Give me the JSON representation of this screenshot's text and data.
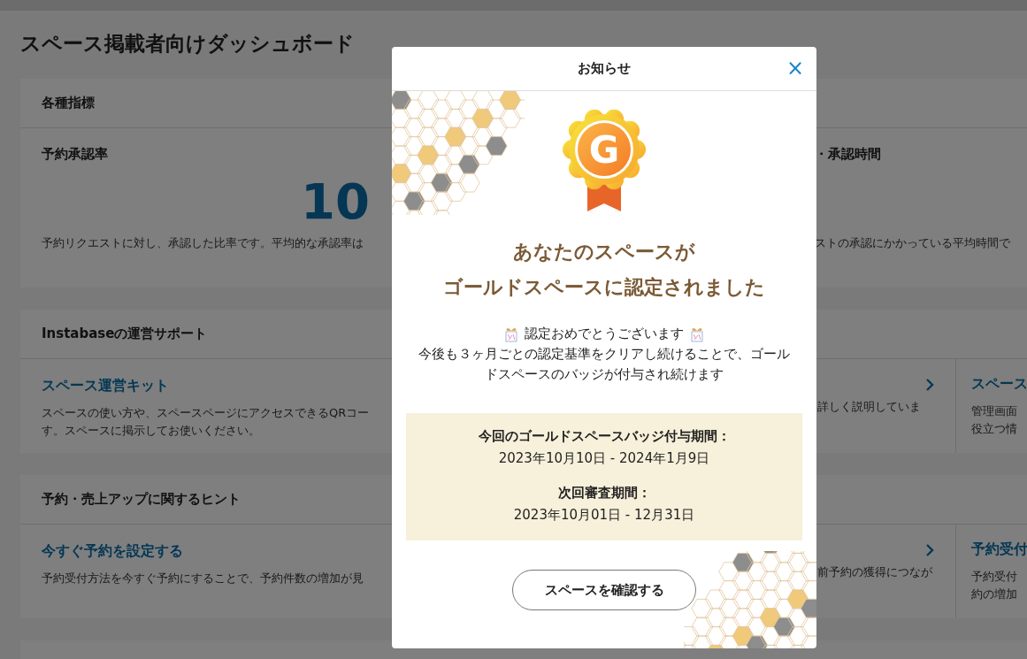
{
  "page": {
    "title": "スペース掲載者向けダッシュボード"
  },
  "sections": [
    {
      "kind": "metrics",
      "heading": "各種指標",
      "left": {
        "title": "予約承認率",
        "value": "10",
        "description": "予約リクエストに対し、承認した比率です。平均的な承認率は"
      },
      "right": {
        "title": "・承認時間",
        "description": "ストの承認にかかっている平均時間で"
      }
    },
    {
      "kind": "links",
      "heading": "Instabaseの運営サポート",
      "left": {
        "title": "スペース運営キット",
        "description": [
          "スペースの使い方や、スペースページにアクセスできるQRコー",
          "す。スペースに掲示してお使いください。"
        ],
        "tail": [
          "詳しく説明していま"
        ]
      },
      "right": {
        "title": "スペース",
        "description": [
          "管理画面",
          "役立つ情"
        ]
      }
    },
    {
      "kind": "links",
      "heading": "予約・売上アップに関するヒント",
      "left": {
        "title": "今すぐ予約を設定する",
        "description": [
          "予約受付方法を今すぐ予約にすることで、予約件数の増加が見"
        ],
        "tail": [
          "前予約の獲得につなが"
        ]
      },
      "right": {
        "title": "予約受付",
        "description": [
          "予約受付",
          "約の増加"
        ]
      }
    }
  ],
  "modal": {
    "title": "お知らせ",
    "close": "×",
    "badge_letter": "G",
    "headline": [
      "あなたのスペースが",
      "ゴールドスペースに認定されました"
    ],
    "greeting": "認定おめでとうございます",
    "message": "今後も３ヶ月ごとの認定基準をクリアし続けることで、ゴールドスペースのバッジが付与され続けます",
    "periods": [
      {
        "label": "今回のゴールドスペースバッジ付与期間：",
        "value": "2023年10月10日 - 2024年1月9日"
      },
      {
        "label": "次回審査期間：",
        "value": "2023年10月01日 - 12月31日"
      }
    ],
    "button": "スペースを確認する"
  }
}
